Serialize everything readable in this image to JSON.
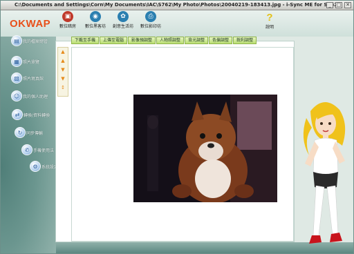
{
  "window": {
    "title": "C:\\Documents and Settings\\Corn\\My Documents\\IAC\\S762\\My Photo\\Photos\\20040219-183413.jpg - i-Sync ME for S762",
    "controls": [
      "_",
      "□",
      "✕"
    ]
  },
  "brand": {
    "logo": "OKWAP"
  },
  "toolbar": {
    "items": [
      {
        "label": "數位暗房",
        "icon": "darkroom-icon",
        "color": "#c0392b"
      },
      {
        "label": "數位黑客坊",
        "icon": "hacker-icon",
        "color": "#2a7fb0"
      },
      {
        "label": "創意生活坊",
        "icon": "creative-icon",
        "color": "#2a7fb0"
      },
      {
        "label": "數位影印坊",
        "icon": "print-icon",
        "color": "#2a7fb0"
      }
    ],
    "help": {
      "symbol": "?",
      "label": "說明"
    }
  },
  "sidebar": {
    "items": [
      {
        "label": "我的檔案總管",
        "icon": "folder-icon"
      },
      {
        "label": "照片瀏覽",
        "icon": "photo-icon"
      },
      {
        "label": "照片寫真館",
        "icon": "album-icon"
      },
      {
        "label": "我的個人助理",
        "icon": "assistant-icon"
      },
      {
        "label": "轉換/資料轉換",
        "icon": "convert-icon"
      },
      {
        "label": "同步傳輸",
        "icon": "sync-icon"
      },
      {
        "label": "手機使用法",
        "icon": "phone-icon"
      },
      {
        "label": "系統設定",
        "icon": "settings-icon"
      }
    ]
  },
  "tabs": [
    {
      "label": "下載至手機"
    },
    {
      "label": "上傳至電腦"
    },
    {
      "label": "影像預調整"
    },
    {
      "label": "人物照調整"
    },
    {
      "label": "背光調整"
    },
    {
      "label": "色偏調整"
    },
    {
      "label": "銳利調整"
    }
  ],
  "side_controls": [
    "▲",
    "▲",
    "▼",
    "▼",
    "↕"
  ],
  "colors": {
    "accent": "#e8501a",
    "tab_green": "#b9de71",
    "panel_teal": "#5f8b86"
  }
}
